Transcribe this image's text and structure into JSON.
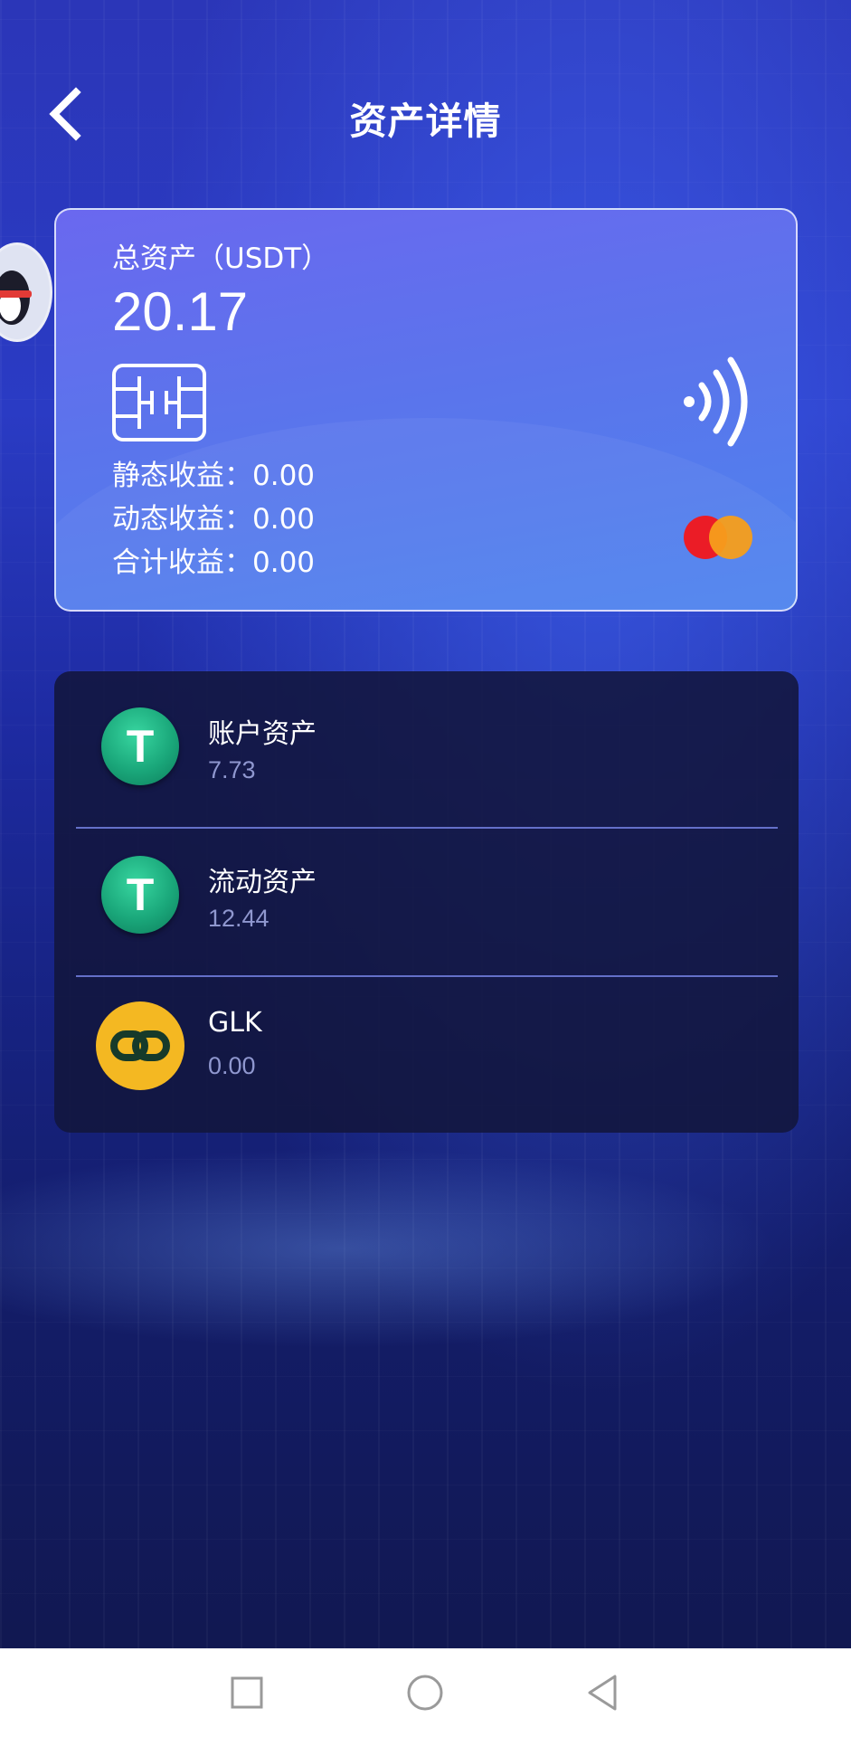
{
  "header": {
    "title": "资产详情"
  },
  "card": {
    "total_label": "总资产（USDT）",
    "total_value": "20.17",
    "static_earnings": "静态收益：0.00",
    "dynamic_earnings": "动态收益：0.00",
    "total_earnings": "合计收益：0.00"
  },
  "assets": [
    {
      "name": "账户资产",
      "value": "7.73",
      "icon": "usdt-icon"
    },
    {
      "name": "流动资产",
      "value": "12.44",
      "icon": "usdt-icon"
    },
    {
      "name": "GLK",
      "value": "0.00",
      "icon": "glk-chain-icon"
    }
  ],
  "colors": {
    "card_start": "#6a68ef",
    "card_end": "#4d83ee",
    "usdt_green": "#1aa77a",
    "glk_yellow": "#f4b822"
  },
  "navbar": {
    "buttons": [
      "recent-apps",
      "home",
      "back"
    ]
  }
}
